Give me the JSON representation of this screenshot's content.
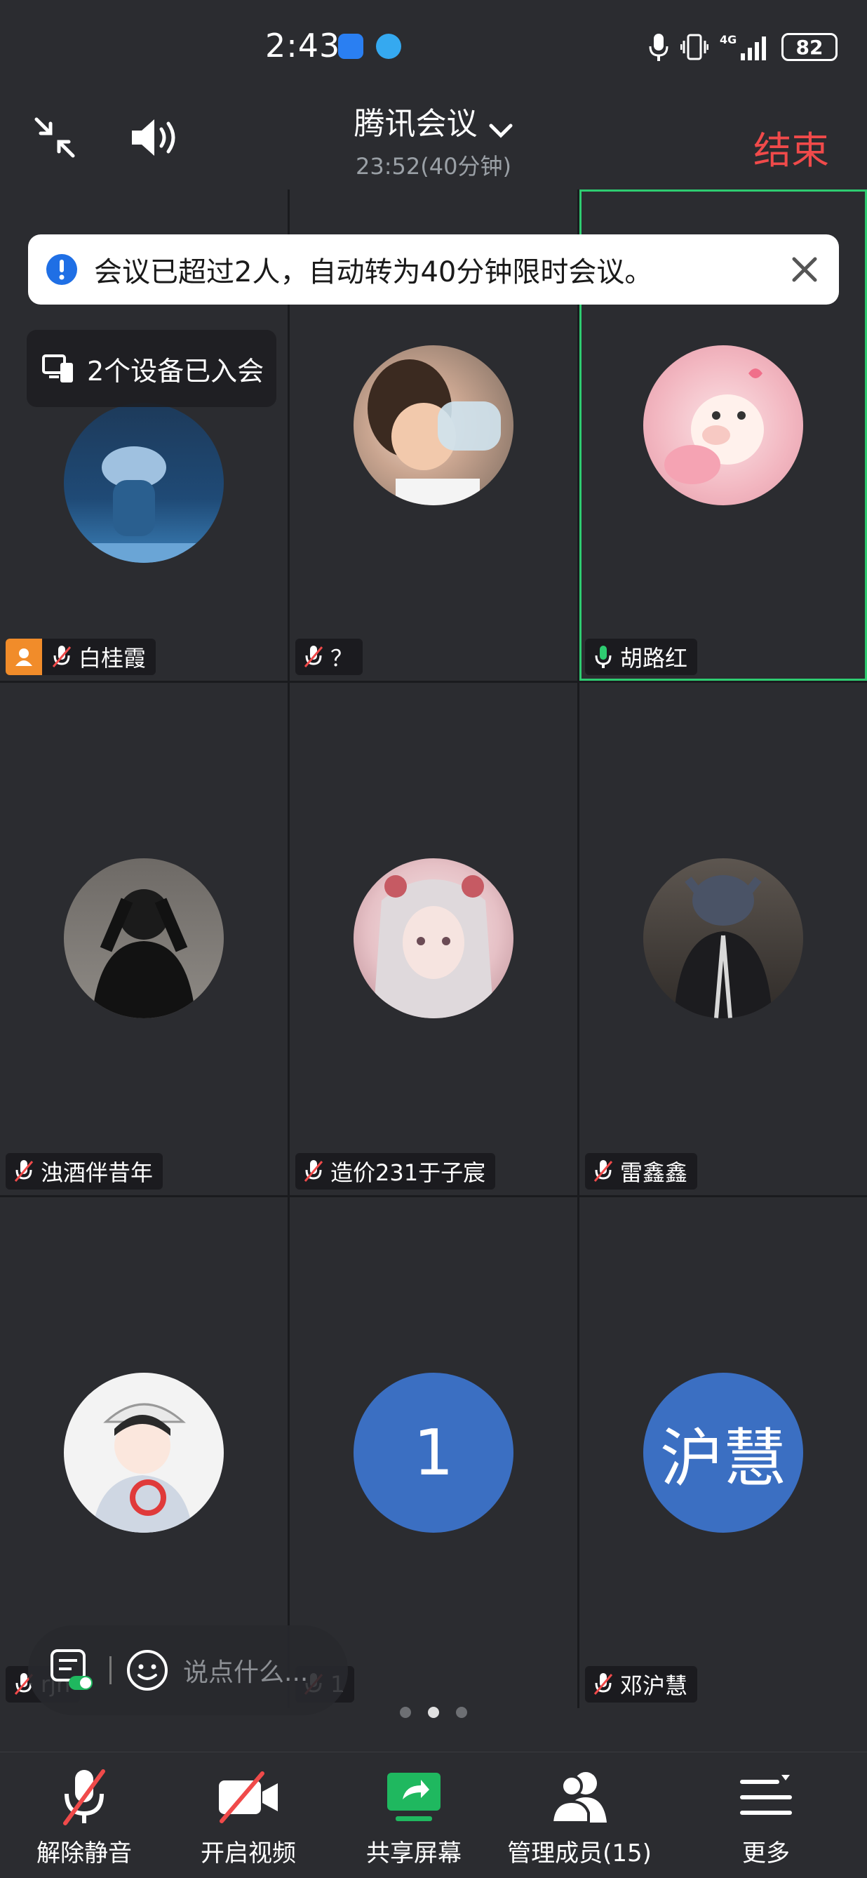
{
  "status_bar": {
    "time": "2:43",
    "network": "4G",
    "battery": "82"
  },
  "header": {
    "title": "腾讯会议",
    "subtitle": "23:52(40分钟)",
    "end_label": "结束"
  },
  "banner": {
    "text": "会议已超过2人，自动转为40分钟限时会议。"
  },
  "device_tip": {
    "text": "2个设备已入会"
  },
  "participants": [
    {
      "name": "白桂霞",
      "mic": "muted",
      "host": true
    },
    {
      "name": "？",
      "mic": "muted"
    },
    {
      "name": "胡路红",
      "mic": "on",
      "active": true
    },
    {
      "name": "浊酒伴昔年",
      "mic": "muted"
    },
    {
      "name": "造价231于子宸",
      "mic": "muted"
    },
    {
      "name": "雷鑫鑫",
      "mic": "muted"
    },
    {
      "name": "rjn",
      "mic": "muted"
    },
    {
      "name": "1",
      "mic": "muted",
      "avatar_text": "1"
    },
    {
      "name": "邓沪慧",
      "mic": "muted",
      "avatar_text": "沪慧"
    }
  ],
  "chat": {
    "placeholder": "说点什么..."
  },
  "toolbar": {
    "unmute": "解除静音",
    "video": "开启视频",
    "share": "共享屏幕",
    "members": "管理成员(15)",
    "more": "更多"
  },
  "colors": {
    "accent": "#3b6fc2",
    "end": "#f04a4a",
    "share_green": "#1fb85f",
    "host_orange": "#f18c2a"
  }
}
